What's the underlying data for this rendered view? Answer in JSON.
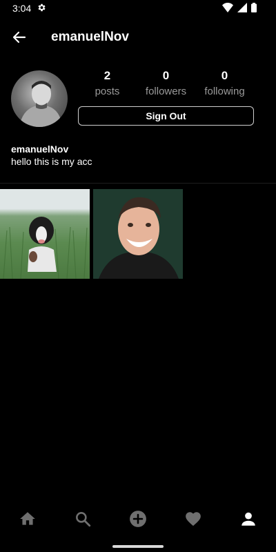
{
  "status_bar": {
    "time": "3:04"
  },
  "header": {
    "title": "emanuelNov"
  },
  "profile": {
    "stats": [
      {
        "count": "2",
        "label": "posts"
      },
      {
        "count": "0",
        "label": "followers"
      },
      {
        "count": "0",
        "label": "following"
      }
    ],
    "signout_label": "Sign Out",
    "username": "emanuelNov",
    "bio": "hello this is my acc"
  },
  "posts": [
    {
      "icon": "dog-in-field-photo"
    },
    {
      "icon": "smiling-man-photo"
    }
  ],
  "nav": [
    {
      "icon": "home-icon"
    },
    {
      "icon": "search-icon"
    },
    {
      "icon": "add-post-icon"
    },
    {
      "icon": "heart-icon"
    },
    {
      "icon": "profile-icon"
    }
  ],
  "colors": {
    "background": "#000000",
    "text": "#ffffff",
    "muted": "#9a9a9a",
    "nav_inactive": "#6f6f6f"
  }
}
